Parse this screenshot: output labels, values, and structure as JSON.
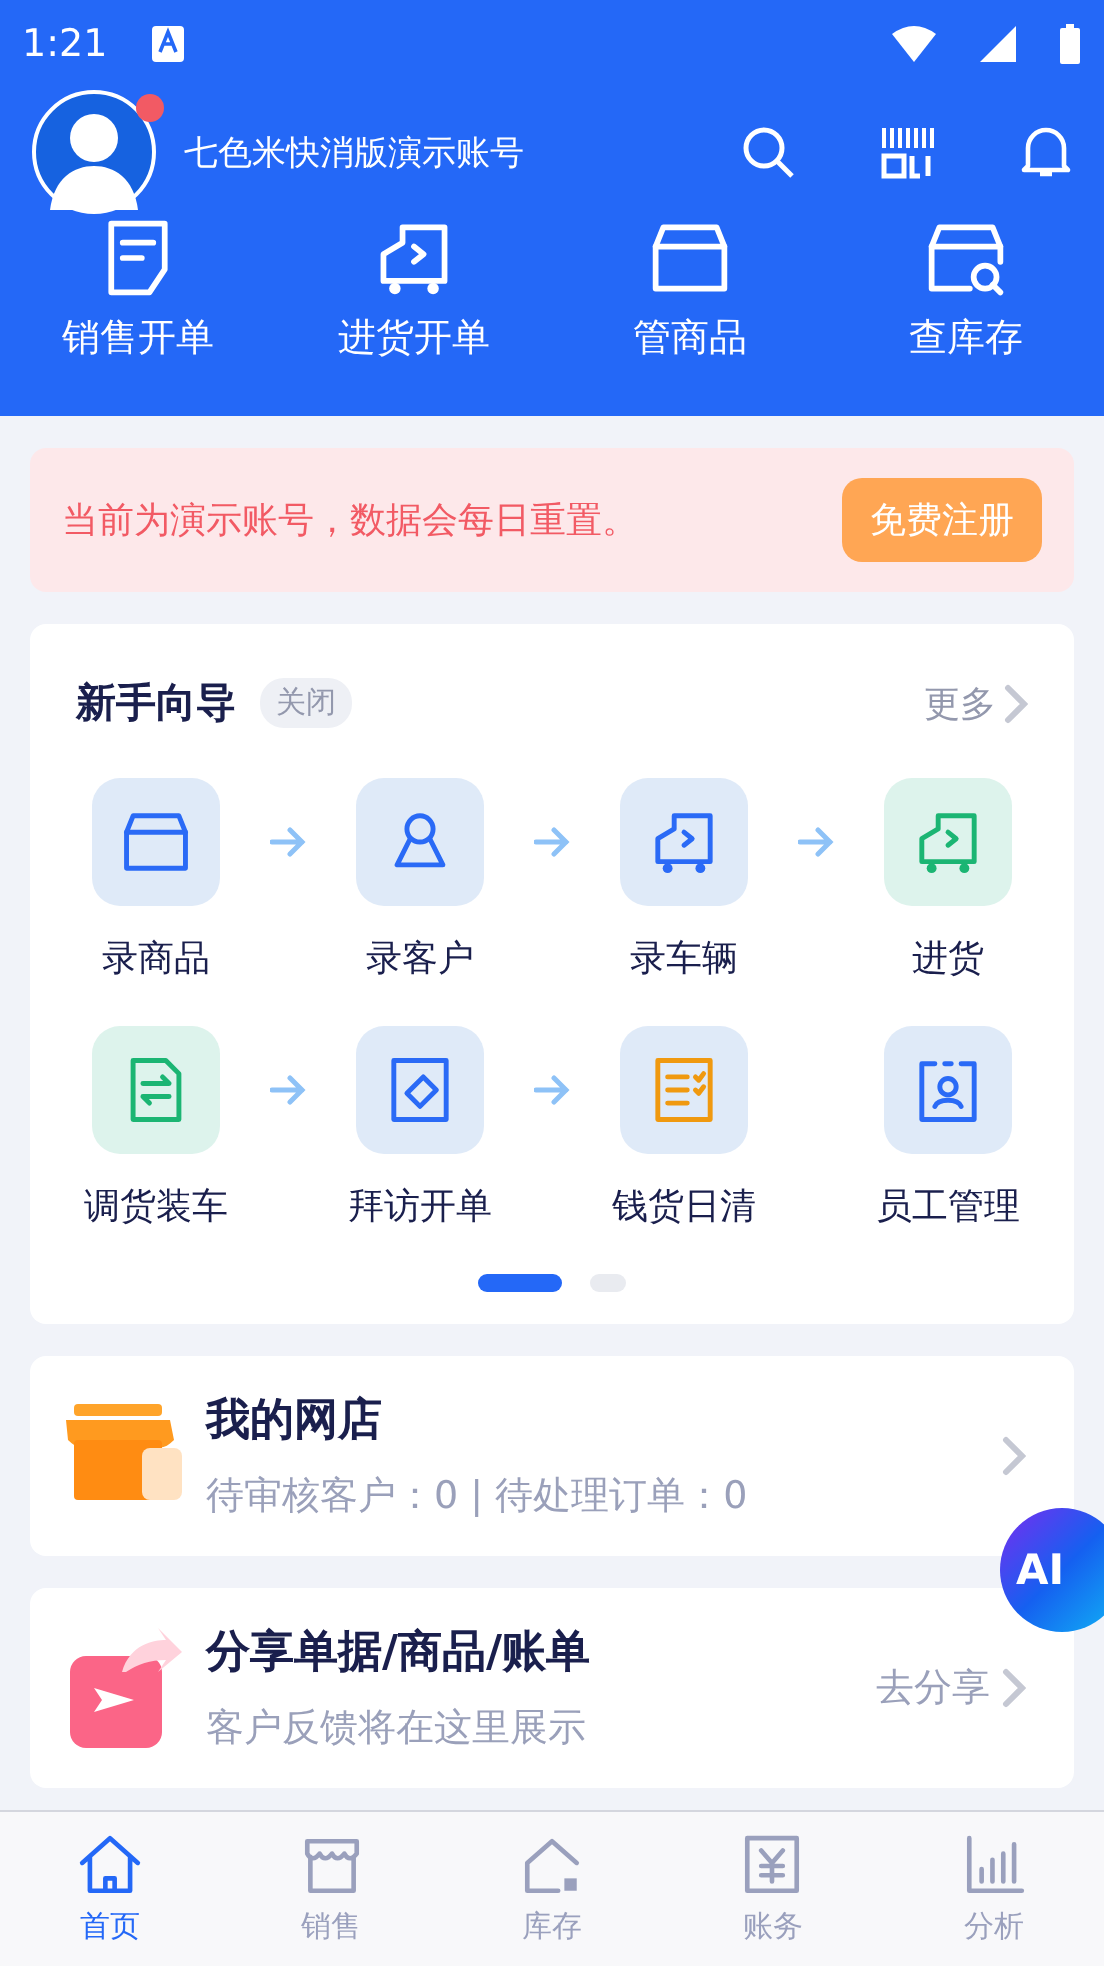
{
  "status_bar": {
    "time": "1:21"
  },
  "header": {
    "account": "七色米快消版演示账号",
    "unread": true
  },
  "quick_actions": [
    {
      "kind": "doc",
      "label": "销售开单"
    },
    {
      "kind": "truck",
      "label": "进货开单"
    },
    {
      "kind": "box",
      "label": "管商品"
    },
    {
      "kind": "boxsearch",
      "label": "查库存"
    }
  ],
  "notice": {
    "text": "当前为演示账号，数据会每日重置。",
    "button": "免费注册"
  },
  "guide": {
    "title": "新手向导",
    "close": "关闭",
    "more": "更多",
    "rows": [
      [
        {
          "kind": "box",
          "color": "#2a6af6",
          "label": "录商品"
        },
        {
          "kind": "person",
          "color": "#2a6af6",
          "label": "录客户",
          "linked": true
        },
        {
          "kind": "truck",
          "color": "#2a6af6",
          "label": "录车辆",
          "linked": true
        },
        {
          "kind": "truck",
          "color": "#1bb573",
          "label": "进货",
          "linked": true
        }
      ],
      [
        {
          "kind": "swap",
          "color": "#1bb573",
          "label": "调货装车"
        },
        {
          "kind": "visit",
          "color": "#2a6af6",
          "label": "拜访开单",
          "linked": true
        },
        {
          "kind": "list",
          "color": "#f0990f",
          "label": "钱货日清",
          "linked": true
        },
        {
          "kind": "badge",
          "color": "#2a6af6",
          "label": "员工管理",
          "linked": false
        }
      ]
    ],
    "pages": [
      {
        "selected": true
      },
      {
        "selected": false
      }
    ]
  },
  "shop": {
    "title": "我的网店",
    "subtitle": "待审核客户：0 | 待处理订单：0"
  },
  "share": {
    "title": "分享单据/商品/账单",
    "subtitle": "客户反馈将在这里展示",
    "action": "去分享"
  },
  "ai_button": "AI",
  "tab_bar": [
    {
      "kind": "home",
      "label": "首页",
      "selected": true
    },
    {
      "kind": "store",
      "label": "销售",
      "selected": false
    },
    {
      "kind": "stock",
      "label": "库存",
      "selected": false
    },
    {
      "kind": "ledger",
      "label": "账务",
      "selected": false
    },
    {
      "kind": "chart",
      "label": "分析",
      "selected": false
    }
  ]
}
